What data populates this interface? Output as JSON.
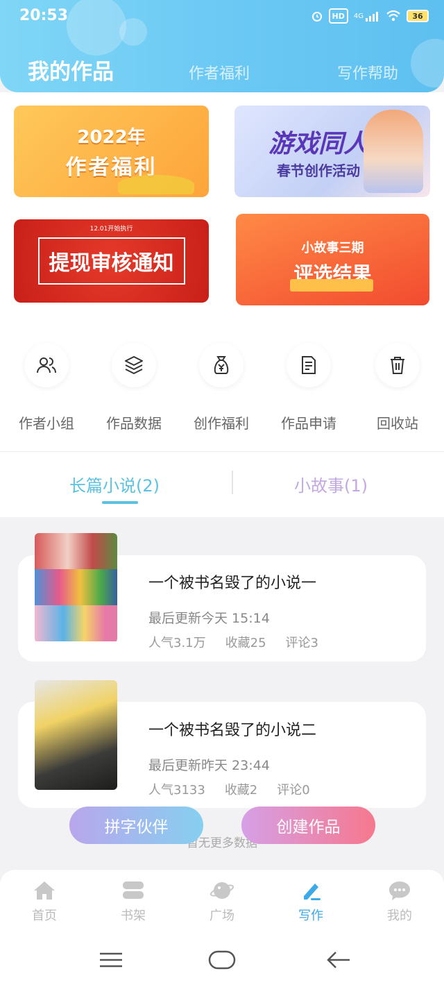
{
  "status": {
    "time": "20:53",
    "hd": "HD",
    "net": "4G",
    "battery": "36"
  },
  "header": {
    "title": "我的作品",
    "tabs": [
      "作者福利",
      "写作帮助"
    ]
  },
  "banners": {
    "b1": {
      "line1": "2022年",
      "line2": "作者福利"
    },
    "b2": {
      "line1": "游戏同人",
      "line2": "春节创作活动"
    },
    "b3": {
      "top": "12.01开始执行",
      "main": "提现审核通知"
    },
    "b4": {
      "line1": "小故事三期",
      "line2": "评选结果"
    }
  },
  "grid": [
    {
      "label": "作者小组",
      "icon": "people-icon"
    },
    {
      "label": "作品数据",
      "icon": "layers-icon"
    },
    {
      "label": "创作福利",
      "icon": "money-bag-icon"
    },
    {
      "label": "作品申请",
      "icon": "document-icon"
    },
    {
      "label": "回收站",
      "icon": "trash-icon"
    }
  ],
  "tabs": {
    "long": "长篇小说(2)",
    "short": "小故事(1)"
  },
  "books": [
    {
      "title": "一个被书名毁了的小说一",
      "update": "最后更新今天 15:14",
      "popularity": "人气3.1万",
      "favorites": "收藏25",
      "comments": "评论3"
    },
    {
      "title": "一个被书名毁了的小说二",
      "update": "最后更新昨天 23:44",
      "popularity": "人气3133",
      "favorites": "收藏2",
      "comments": "评论0"
    }
  ],
  "no_more": "暂无更多数据",
  "buttons": {
    "partner": "拼字伙伴",
    "create": "创建作品"
  },
  "nav": [
    {
      "label": "首页",
      "icon": "home-icon"
    },
    {
      "label": "书架",
      "icon": "bookshelf-icon"
    },
    {
      "label": "广场",
      "icon": "planet-icon"
    },
    {
      "label": "写作",
      "icon": "pen-icon"
    },
    {
      "label": "我的",
      "icon": "chat-icon"
    }
  ],
  "colors": {
    "header": "#6cc9f4",
    "accent": "#5ac2e0",
    "nav_active": "#3da9e6"
  }
}
